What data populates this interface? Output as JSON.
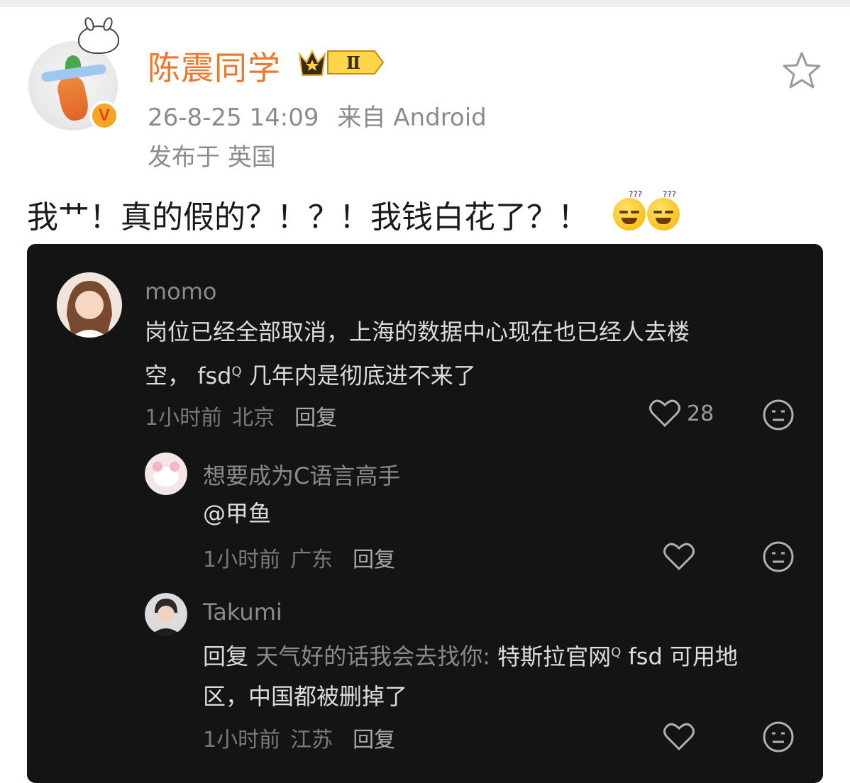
{
  "post": {
    "username": "陈震同学",
    "vip_level": "Ⅱ",
    "verified_mark": "V",
    "timestamp": "26-8-25 14:09",
    "source": "来自 Android",
    "location": "发布于 英国",
    "text": "我艹！真的假的？！？！我钱白花了？！",
    "emoji": [
      "smirk-face-emoji",
      "smirk-face-emoji"
    ],
    "emoji_marks": "???",
    "colors": {
      "username": "#f0762c",
      "meta": "#8c8c8c",
      "text": "#1a1a1a"
    }
  },
  "screenshot": {
    "comments": [
      {
        "author": "momo",
        "text": [
          "岗位已经全部取消，上海的数据中心现在也已经人去楼",
          "空，"
        ],
        "text_tail_link": "fsd",
        "text_tail_mark": "Q",
        "text_tail": "几年内是彻底进不来了",
        "time": "1小时前",
        "location": "北京",
        "reply_label": "回复",
        "likes": "28"
      },
      {
        "author": "想要成为C语言高手",
        "text": "@甲鱼",
        "time": "1小时前",
        "location": "广东",
        "reply_label": "回复"
      },
      {
        "author": "Takumi",
        "reply_prefix": "回复",
        "reply_to": "天气好的话我会去找你:",
        "text_link": "特斯拉官网",
        "text_link_mark": "Q",
        "text_after": "fsd 可用地",
        "text_line2": "区，中国都被删掉了",
        "time": "1小时前",
        "location": "江苏",
        "reply_label": "回复"
      }
    ],
    "colors": {
      "background": "#141414",
      "name": "#8a8a8a",
      "body": "#dcdcdc"
    }
  }
}
